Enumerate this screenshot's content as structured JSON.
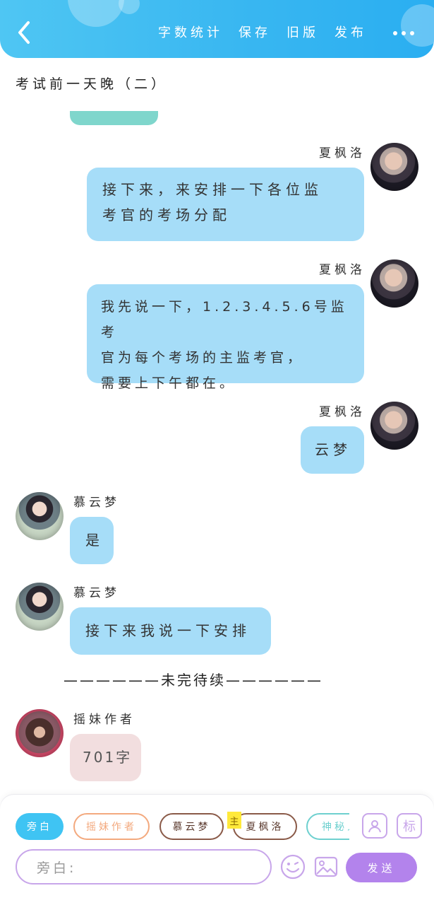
{
  "header": {
    "menu": [
      "字数统计",
      "保存",
      "旧版",
      "发布"
    ]
  },
  "document": {
    "title": "考试前一天晚（二）"
  },
  "messages": [
    {
      "sender": "夏枫洛",
      "text_lines": [
        "接下来，来安排一下各位监",
        "考官的考场分配"
      ]
    },
    {
      "sender": "夏枫洛",
      "text_lines": [
        "我先说一下，1.2.3.4.5.6号监考",
        "官为每个考场的主监考官，",
        "需要上下午都在。"
      ]
    },
    {
      "sender": "夏枫洛",
      "text": "云梦"
    },
    {
      "sender": "慕云梦",
      "text": "是"
    },
    {
      "sender": "慕云梦",
      "text": "接下来我说一下安排"
    },
    {
      "divider": "——————未完待续——————"
    },
    {
      "sender": "摇妹作者",
      "text": "701字"
    }
  ],
  "composer": {
    "roles": [
      "旁白",
      "摇妹作者",
      "慕云梦",
      "夏枫洛",
      "神秘人"
    ],
    "main_tag": "主",
    "character_icon_label": "",
    "mark_label": "标",
    "input_placeholder": "旁白:",
    "send_label": "发送"
  },
  "colors": {
    "header_start": "#4fc6f3",
    "header_end": "#2aaef1",
    "bubble_blue": "#a6ddf8",
    "bubble_pink": "#f2dedf",
    "accent_purple": "#b383ec"
  }
}
